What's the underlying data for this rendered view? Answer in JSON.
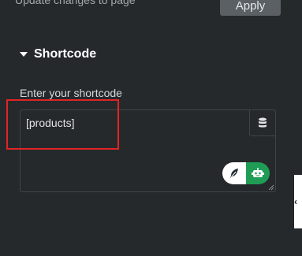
{
  "header": {
    "update_text": "Update changes to page",
    "apply_label": "Apply"
  },
  "section": {
    "title": "Shortcode"
  },
  "field": {
    "label": "Enter your shortcode",
    "value": "[products]"
  },
  "icons": {
    "section_toggle": "caret-down-icon",
    "dynamic_tags": "database-icon",
    "ai_write": "feather-icon",
    "ai_assistant": "robot-icon",
    "resize": "resize-grip-icon",
    "panel_collapse": "chevron-left-icon"
  },
  "colors": {
    "background": "#26292c",
    "apply_button": "#5b6065",
    "ai_green": "#1f9d55",
    "highlight": "#e02424"
  }
}
